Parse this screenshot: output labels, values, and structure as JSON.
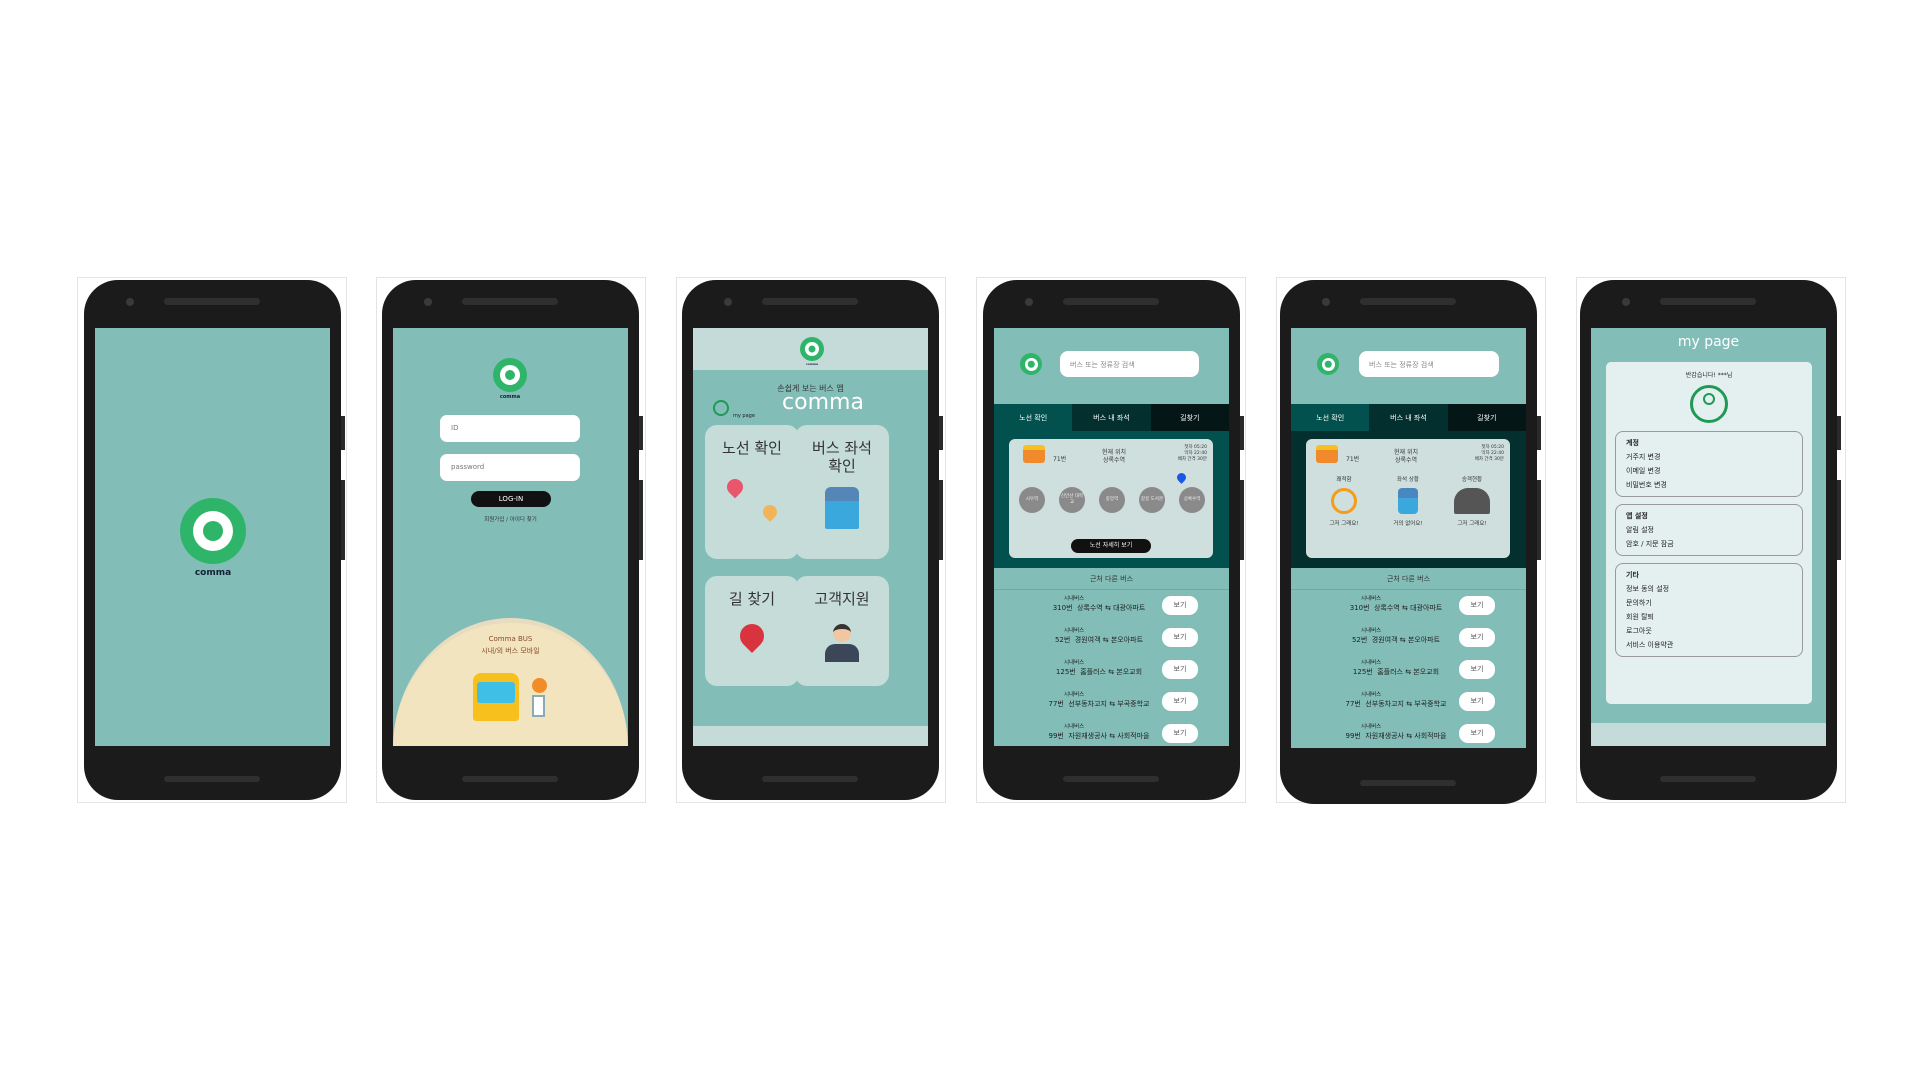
{
  "brand": {
    "name": "comma",
    "accent": "#2fb56a",
    "teal": "#82bdb7",
    "dark_teal": "#03514f"
  },
  "splash": {
    "logo_caption": "comma"
  },
  "login": {
    "logo_caption": "comma",
    "id_placeholder": "ID",
    "password_placeholder": "password",
    "login_button": "LOG-IN",
    "signup_link": "회원가입 / 아이디 찾기",
    "banner_title": "Comma BUS",
    "banner_subtitle": "시내/외 버스 모바일"
  },
  "home": {
    "logo_caption": "comma",
    "tagline": "손쉽게 보는 버스 앱",
    "title": "comma",
    "mypage_label": "my page",
    "tiles": [
      {
        "label": "노선 확인",
        "icon": "map-route-icon"
      },
      {
        "label": "버스 좌석 확인",
        "icon": "bus-seat-icon"
      },
      {
        "label": "길 찾기",
        "icon": "location-pin-icon"
      },
      {
        "label": "고객지원",
        "icon": "support-agent-icon"
      }
    ]
  },
  "route": {
    "search_placeholder": "버스 또는 정류장 검색",
    "tabs": [
      "노선 확인",
      "버스 내 좌석",
      "길찾기"
    ],
    "bus_number": "71번",
    "current_label": "현재 위치",
    "current_stop": "상록수역",
    "first_bus": "첫차 05:20",
    "last_bus": "막차 22:40",
    "interval": "배차 간격 30분",
    "stops": [
      "시우역",
      "신안산 대학교",
      "중앙역",
      "갈골 도서관",
      "상록수역"
    ],
    "detail_button": "노선 자세히 보기"
  },
  "seat": {
    "search_placeholder": "버스 또는 정류장 검색",
    "tabs": [
      "노선 확인",
      "버스 내 좌석",
      "길찾기"
    ],
    "bus_number": "71번",
    "current_label": "현재 위치",
    "current_stop": "상록수역",
    "first_bus": "첫차 05:20",
    "last_bus": "막차 22:40",
    "interval": "배차 간격 30분",
    "status": [
      {
        "title": "쾌적함",
        "value": "그저 그래요!"
      },
      {
        "title": "좌석 상황",
        "value": "거의 없어요!"
      },
      {
        "title": "승객현황",
        "value": "그저 그래요!"
      }
    ]
  },
  "nearby": {
    "title": "근처 다른 버스",
    "view_label": "보기",
    "rows": [
      {
        "kind": "시내버스",
        "number": "310번",
        "from": "상록수역",
        "to": "대광아파트"
      },
      {
        "kind": "시내버스",
        "number": "52번",
        "from": "경원여객",
        "to": "본오아파트"
      },
      {
        "kind": "시내버스",
        "number": "125번",
        "from": "홈플러스",
        "to": "본오교회"
      },
      {
        "kind": "시내버스",
        "number": "77번",
        "from": "선부동차고지",
        "to": "부곡중학교"
      },
      {
        "kind": "시내버스",
        "number": "99번",
        "from": "자원재생공사",
        "to": "사회적마을"
      }
    ]
  },
  "mypage": {
    "title": "my page",
    "greeting": "반갑습니다! ***님",
    "sections": [
      {
        "title": "계정",
        "items": [
          "거주지 변경",
          "이메일 변경",
          "비밀번호 변경"
        ]
      },
      {
        "title": "앱 설정",
        "items": [
          "알림 설정",
          "암호 / 지문 잠금"
        ]
      },
      {
        "title": "기타",
        "items": [
          "정보 동의 설정",
          "문의하기",
          "회원 탈퇴",
          "로그아웃",
          "서비스 이용약관"
        ]
      }
    ]
  }
}
